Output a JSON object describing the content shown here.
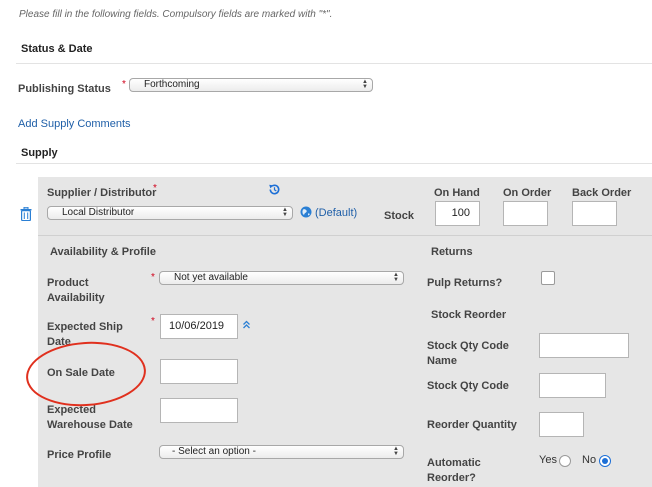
{
  "intro_text": "Please fill in the following fields. Compulsory fields are marked with \"*\".",
  "status_date": {
    "title": "Status & Date",
    "publishing_status_label": "Publishing Status",
    "publishing_status_value": "Forthcoming"
  },
  "add_supply_comments": "Add Supply Comments",
  "supply": {
    "title": "Supply",
    "supplier_label": "Supplier / Distributor",
    "supplier_value": "Local Distributor",
    "default_label": "(Default)",
    "stock_label": "Stock",
    "on_hand_label": "On Hand",
    "on_hand_value": "100",
    "on_order_label": "On Order",
    "on_order_value": "",
    "back_order_label": "Back Order",
    "back_order_value": ""
  },
  "availability": {
    "title": "Availability & Profile",
    "product_availability_label_1": "Product",
    "product_availability_label_2": "Availability",
    "product_availability_value": "Not yet available",
    "expected_ship_label_1": "Expected Ship",
    "expected_ship_label_2": "Date",
    "expected_ship_value": "10/06/2019",
    "on_sale_label": "On Sale Date",
    "on_sale_value": "",
    "expected_warehouse_label_1": "Expected",
    "expected_warehouse_label_2": "Warehouse Date",
    "expected_warehouse_value": "",
    "price_profile_label": "Price Profile",
    "price_profile_value": "- Select an option -"
  },
  "returns": {
    "title": "Returns",
    "pulp_returns_label": "Pulp Returns?"
  },
  "stock_reorder": {
    "title": "Stock Reorder",
    "stock_qty_code_name_label_1": "Stock Qty Code",
    "stock_qty_code_name_label_2": "Name",
    "stock_qty_code_label": "Stock Qty Code",
    "reorder_quantity_label": "Reorder Quantity",
    "automatic_reorder_label_1": "Automatic",
    "automatic_reorder_label_2": "Reorder?",
    "yes_label": "Yes",
    "no_label": "No",
    "selected": "No"
  },
  "required_marker": "*",
  "colors": {
    "required": "#d0021b",
    "link": "#1f5fa8",
    "panel": "#e6e6e6",
    "annotation": "#e0301e"
  }
}
